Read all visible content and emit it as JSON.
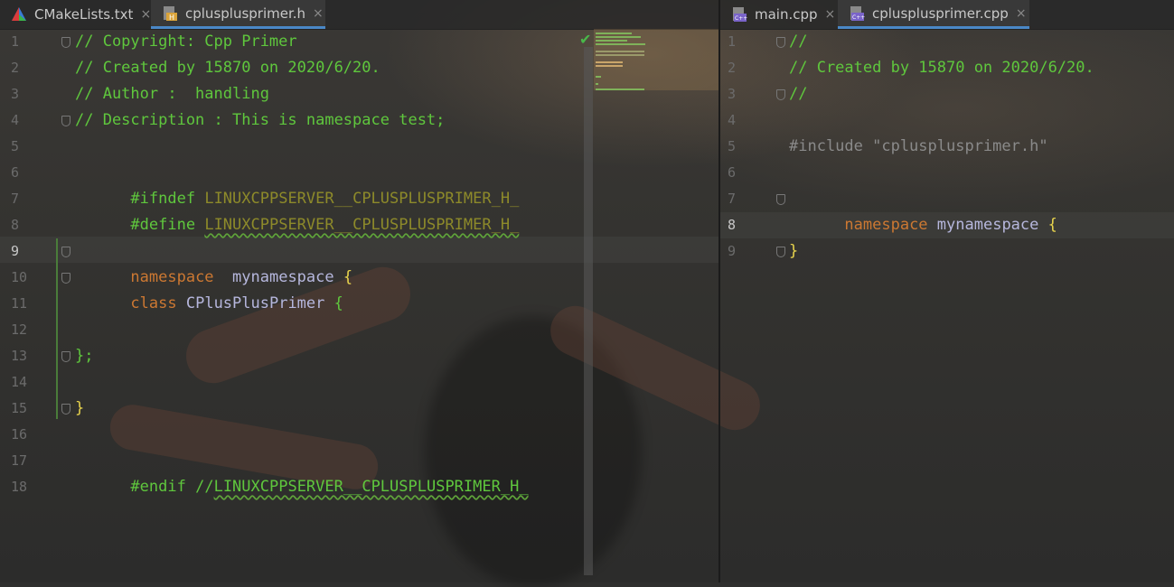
{
  "left_tabs": [
    {
      "label": "CMakeLists.txt",
      "icon": "cmake-icon",
      "active": false
    },
    {
      "label": "cplusplusprimer.h",
      "icon": "header-file-icon",
      "active": true
    }
  ],
  "right_tabs": [
    {
      "label": "main.cpp",
      "icon": "cpp-file-icon",
      "active": false
    },
    {
      "label": "cplusplusprimer.cpp",
      "icon": "cpp-file-icon",
      "active": true
    }
  ],
  "close_glyph": "×",
  "left_editor": {
    "current_line": 9,
    "line_numbers": [
      "1",
      "2",
      "3",
      "4",
      "5",
      "6",
      "7",
      "8",
      "9",
      "10",
      "11",
      "12",
      "13",
      "14",
      "15",
      "16",
      "17",
      "18"
    ],
    "lines": {
      "l1": "// Copyright: Cpp Primer",
      "l2": "// Created by 15870 on 2020/6/20.",
      "l3": "// Author :  handling",
      "l4": "// Description : This is namespace test;",
      "l6_dir": "#ifndef",
      "l6_macro": "LINUXCPPSERVER__CPLUSPLUSPRIMER_H_",
      "l7_dir": "#define",
      "l7_macro": "LINUXCPPSERVER__CPLUSPLUSPRIMER_H_",
      "l9_kw": "namespace",
      "l9_name": "mynamespace",
      "l9_brace": "{",
      "l10_kw": "class",
      "l10_name": "CPlusPlusPrimer",
      "l10_brace": "{",
      "l13": "};",
      "l15": "}",
      "l17_dir": "#endif",
      "l17_comment": "//",
      "l17_macro": "LINUXCPPSERVER__CPLUSPLUSPRIMER_H_"
    }
  },
  "right_editor": {
    "current_line": 8,
    "line_numbers": [
      "1",
      "2",
      "3",
      "4",
      "5",
      "6",
      "7",
      "8",
      "9"
    ],
    "lines": {
      "l1": "//",
      "l2": "// Created by 15870 on 2020/6/20.",
      "l3": "//",
      "l5": "#include \"cplusplusprimer.h\"",
      "l7_kw": "namespace",
      "l7_name": "mynamespace",
      "l7_brace": "{",
      "l9": "}"
    }
  },
  "colors": {
    "comment": "#5fc73d",
    "keyword": "#cc7832",
    "macro": "#8d8a2a",
    "brace": "#e8d44d",
    "accent": "#4a88c7"
  }
}
